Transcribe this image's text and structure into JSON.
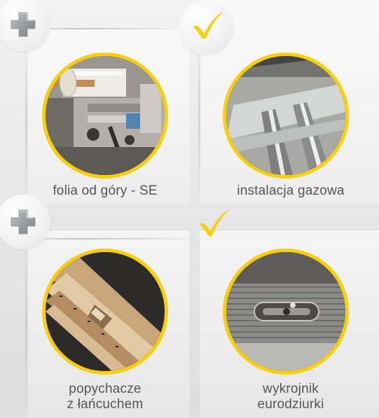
{
  "colors": {
    "accent_yellow": "#f7cf0b",
    "text": "#555555",
    "plus_icon": "#9a9fa3"
  },
  "tiles": [
    {
      "icon": "plus-icon",
      "caption_lines": [
        "folia od góry  - SE"
      ]
    },
    {
      "icon": "check-icon",
      "caption_lines": [
        "instalacja gazowa"
      ]
    },
    {
      "icon": "plus-icon",
      "caption_lines": [
        "popychacze",
        "z łańcuchem"
      ]
    },
    {
      "icon": "check-icon",
      "caption_lines": [
        "wykrojnik",
        "eurodziurki"
      ]
    }
  ]
}
